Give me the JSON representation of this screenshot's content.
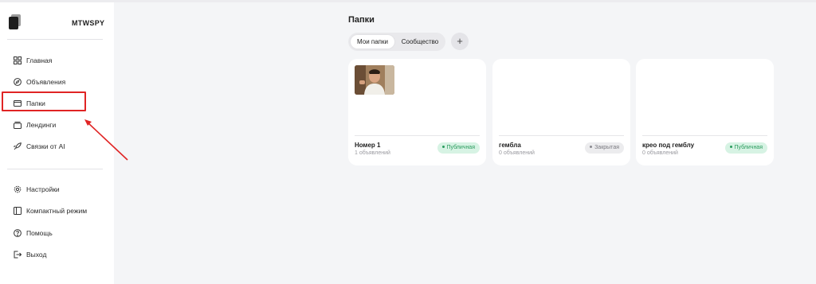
{
  "app": {
    "brand": "MTWSPY"
  },
  "sidebar": {
    "items": [
      {
        "label": "Главная",
        "icon": "grid-icon"
      },
      {
        "label": "Объявления",
        "icon": "compass-icon"
      },
      {
        "label": "Папки",
        "icon": "folder-icon"
      },
      {
        "label": "Лендинги",
        "icon": "layers-icon"
      },
      {
        "label": "Связки от AI",
        "icon": "rocket-icon"
      }
    ],
    "bottom_items": [
      {
        "label": "Настройки",
        "icon": "gear-icon"
      },
      {
        "label": "Компактный режим",
        "icon": "sidebar-toggle-icon"
      },
      {
        "label": "Помощь",
        "icon": "help-icon"
      },
      {
        "label": "Выход",
        "icon": "logout-icon"
      }
    ]
  },
  "main": {
    "title": "Папки",
    "tabs": [
      {
        "label": "Мои папки",
        "active": true
      },
      {
        "label": "Сообщество",
        "active": false
      }
    ],
    "add_label": "+",
    "folders": [
      {
        "name": "Номер 1",
        "count": "1 объявлений",
        "status": "Публичная",
        "status_type": "public",
        "has_thumbnail": true
      },
      {
        "name": "гембла",
        "count": "0 объявлений",
        "status": "Закрытая",
        "status_type": "closed",
        "has_thumbnail": false
      },
      {
        "name": "крео под гемблу",
        "count": "0 объявлений",
        "status": "Публичная",
        "status_type": "public",
        "has_thumbnail": false
      }
    ]
  },
  "annotation": {
    "highlight_color": "#e02424",
    "target": "Папки"
  },
  "colors": {
    "public_bg": "#d7f3e4",
    "public_text": "#2a9b5d",
    "closed_bg": "#ececee",
    "closed_text": "#7a7a80"
  }
}
